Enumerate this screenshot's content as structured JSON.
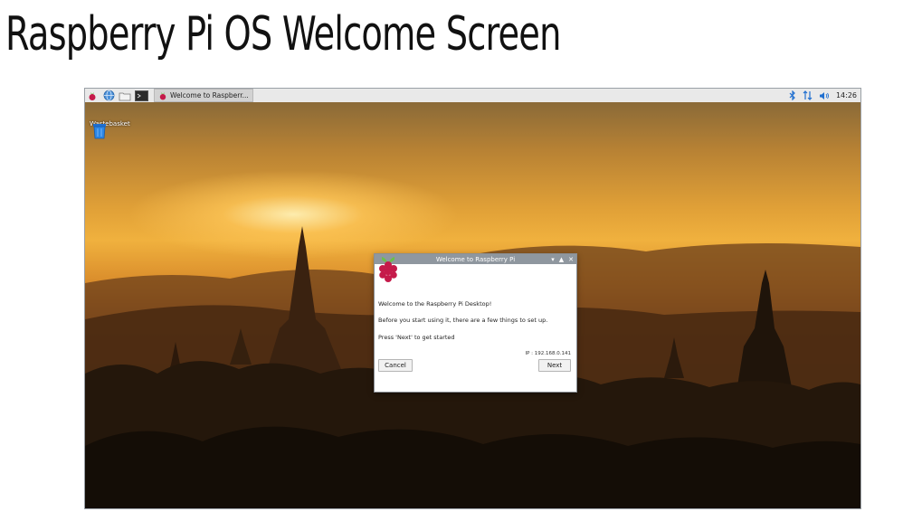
{
  "slide": {
    "title": "Raspberry Pi OS Welcome Screen"
  },
  "taskbar": {
    "menu_icon": "raspberry-menu-icon",
    "launchers": [
      "globe-browser-icon",
      "folder-icon",
      "terminal-icon"
    ],
    "task": {
      "label": "Welcome to Raspberr...",
      "icon": "raspberry-icon"
    },
    "tray": [
      "bluetooth-icon",
      "network-icon",
      "volume-icon"
    ],
    "clock": "14:26"
  },
  "desktop": {
    "icons": [
      {
        "label": "Wastebasket",
        "icon": "trash-icon"
      }
    ]
  },
  "dialog": {
    "title": "Welcome to Raspberry Pi",
    "heading": "Welcome to the Raspberry Pi Desktop!",
    "line1": "Before you start using it, there are a few things to set up.",
    "line2": "Press 'Next' to get started",
    "ip": "IP : 192.168.0.141",
    "cancel_label": "Cancel",
    "next_label": "Next",
    "controls": [
      "minimize-icon",
      "maximize-icon",
      "close-icon"
    ]
  },
  "colors": {
    "taskbar_bg": "#e9e9e9",
    "titlebar_bg": "#8f979f",
    "raspberry_red": "#c51a4a",
    "leaf_green": "#6cc04a"
  }
}
